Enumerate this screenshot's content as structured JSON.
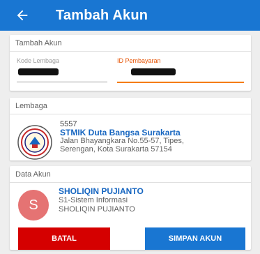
{
  "appbar": {
    "title": "Tambah Akun",
    "back_icon": "arrow-left-icon",
    "color": "#1976d2"
  },
  "form": {
    "section_title": "Tambah Akun",
    "kode_lembaga_label": "Kode Lembaga",
    "id_pembayaran_label": "ID Pembayaran"
  },
  "institution": {
    "section_title": "Lembaga",
    "code": "5557",
    "name": "STMIK Duta Bangsa Surakarta",
    "address_line1": "Jalan Bhayangkara No.55-57, Tipes,",
    "address_line2": "Serengan, Kota Surakarta 57154"
  },
  "account": {
    "section_title": "Data Akun",
    "avatar_initial": "S",
    "name": "SHOLIQIN PUJIANTO",
    "program": "S1-Sistem Informasi",
    "username": "SHOLIQIN PUJIANTO"
  },
  "actions": {
    "cancel_label": "BATAL",
    "save_label": "SIMPAN AKUN",
    "cancel_color": "#d50000",
    "save_color": "#1976d2"
  }
}
